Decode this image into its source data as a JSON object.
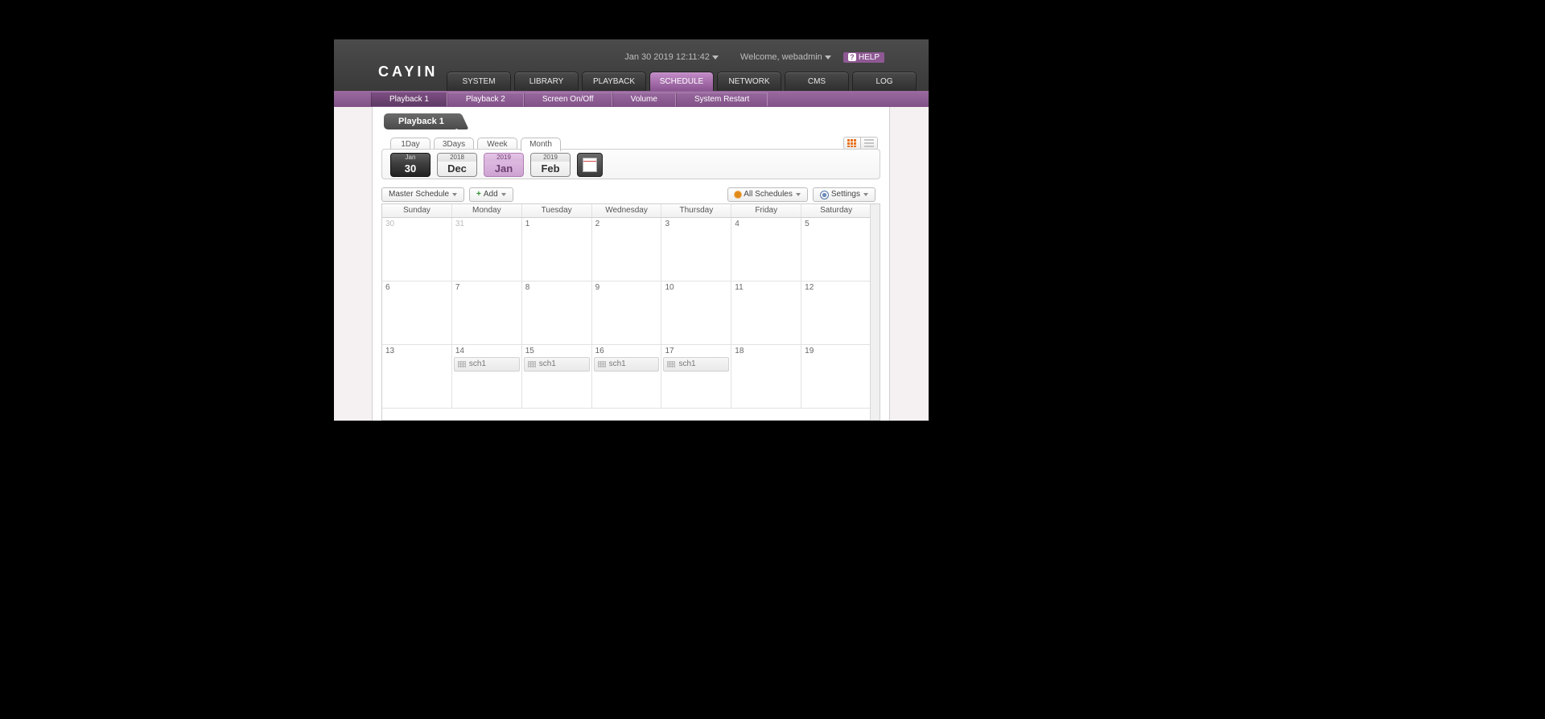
{
  "header": {
    "logo": "CAYIN",
    "datetime": "Jan 30 2019 12:11:42",
    "welcome": "Welcome, webadmin",
    "help": "HELP"
  },
  "mainnav": [
    {
      "label": "SYSTEM",
      "active": false
    },
    {
      "label": "LIBRARY",
      "active": false
    },
    {
      "label": "PLAYBACK",
      "active": false
    },
    {
      "label": "SCHEDULE",
      "active": true
    },
    {
      "label": "NETWORK",
      "active": false
    },
    {
      "label": "CMS",
      "active": false
    },
    {
      "label": "LOG",
      "active": false
    }
  ],
  "subnav": [
    {
      "label": "Playback 1",
      "active": true
    },
    {
      "label": "Playback 2",
      "active": false
    },
    {
      "label": "Screen On/Off",
      "active": false
    },
    {
      "label": "Volume",
      "active": false
    },
    {
      "label": "System Restart",
      "active": false
    }
  ],
  "panel": {
    "title": "Playback 1"
  },
  "viewtabs": [
    {
      "label": "1Day",
      "active": false
    },
    {
      "label": "3Days",
      "active": false
    },
    {
      "label": "Week",
      "active": false
    },
    {
      "label": "Month",
      "active": true
    }
  ],
  "datechips": [
    {
      "top": "Jan",
      "bottom": "30",
      "style": "today"
    },
    {
      "top": "2018",
      "bottom": "Dec",
      "style": "plain"
    },
    {
      "top": "2019",
      "bottom": "Jan",
      "style": "sel"
    },
    {
      "top": "2019",
      "bottom": "Feb",
      "style": "plain"
    }
  ],
  "toolbar": {
    "master": "Master Schedule",
    "add": "Add",
    "all": "All Schedules",
    "settings": "Settings"
  },
  "weekdays": [
    "Sunday",
    "Monday",
    "Tuesday",
    "Wednesday",
    "Thursday",
    "Friday",
    "Saturday"
  ],
  "rows": [
    [
      {
        "n": "30",
        "out": true
      },
      {
        "n": "31",
        "out": true
      },
      {
        "n": "1"
      },
      {
        "n": "2"
      },
      {
        "n": "3"
      },
      {
        "n": "4"
      },
      {
        "n": "5"
      }
    ],
    [
      {
        "n": "6"
      },
      {
        "n": "7"
      },
      {
        "n": "8"
      },
      {
        "n": "9"
      },
      {
        "n": "10"
      },
      {
        "n": "11"
      },
      {
        "n": "12"
      }
    ],
    [
      {
        "n": "13"
      },
      {
        "n": "14",
        "evt": "sch1"
      },
      {
        "n": "15",
        "evt": "sch1"
      },
      {
        "n": "16",
        "evt": "sch1"
      },
      {
        "n": "17",
        "evt": "sch1"
      },
      {
        "n": "18"
      },
      {
        "n": "19"
      }
    ]
  ]
}
